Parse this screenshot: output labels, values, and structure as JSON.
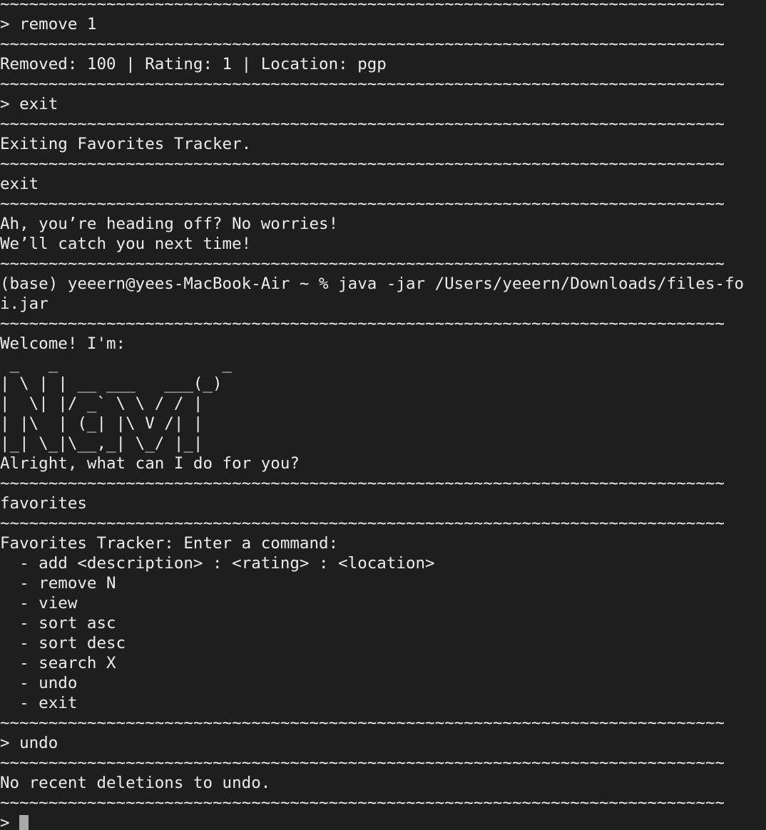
{
  "terminal": {
    "lines": [
      "~~~~~~~~~~~~~~~~~~~~~~~~~~~~~~~~~~~~~~~~~~~~~~~~~~~~~~~~~~~~~~~~~~~~~~~~~~~",
      "> remove 1",
      "~~~~~~~~~~~~~~~~~~~~~~~~~~~~~~~~~~~~~~~~~~~~~~~~~~~~~~~~~~~~~~~~~~~~~~~~~~~",
      "Removed: 100 | Rating: 1 | Location: pgp",
      "~~~~~~~~~~~~~~~~~~~~~~~~~~~~~~~~~~~~~~~~~~~~~~~~~~~~~~~~~~~~~~~~~~~~~~~~~~~",
      "> exit",
      "~~~~~~~~~~~~~~~~~~~~~~~~~~~~~~~~~~~~~~~~~~~~~~~~~~~~~~~~~~~~~~~~~~~~~~~~~~~",
      "Exiting Favorites Tracker.",
      "~~~~~~~~~~~~~~~~~~~~~~~~~~~~~~~~~~~~~~~~~~~~~~~~~~~~~~~~~~~~~~~~~~~~~~~~~~~",
      "exit",
      "~~~~~~~~~~~~~~~~~~~~~~~~~~~~~~~~~~~~~~~~~~~~~~~~~~~~~~~~~~~~~~~~~~~~~~~~~~~",
      "Ah, you’re heading off? No worries!",
      "We’ll catch you next time!",
      "~~~~~~~~~~~~~~~~~~~~~~~~~~~~~~~~~~~~~~~~~~~~~~~~~~~~~~~~~~~~~~~~~~~~~~~~~~~",
      "(base) yeeern@yees-MacBook-Air ~ % java -jar /Users/yeeern/Downloads/files-fo",
      "i.jar",
      "~~~~~~~~~~~~~~~~~~~~~~~~~~~~~~~~~~~~~~~~~~~~~~~~~~~~~~~~~~~~~~~~~~~~~~~~~~~",
      "Welcome! I'm:",
      " _   _                 _ ",
      "| \\ | | __ ___   ___(_)",
      "|  \\| |/ _` \\ \\ / / |",
      "| |\\  | (_| |\\ V /| |",
      "|_| \\_|\\__,_| \\_/ |_|",
      "Alright, what can I do for you?",
      "~~~~~~~~~~~~~~~~~~~~~~~~~~~~~~~~~~~~~~~~~~~~~~~~~~~~~~~~~~~~~~~~~~~~~~~~~~~",
      "favorites",
      "~~~~~~~~~~~~~~~~~~~~~~~~~~~~~~~~~~~~~~~~~~~~~~~~~~~~~~~~~~~~~~~~~~~~~~~~~~~",
      "Favorites Tracker: Enter a command:",
      "  - add <description> : <rating> : <location>",
      "  - remove N",
      "  - view",
      "  - sort asc",
      "  - sort desc",
      "  - search X",
      "  - undo",
      "  - exit",
      "~~~~~~~~~~~~~~~~~~~~~~~~~~~~~~~~~~~~~~~~~~~~~~~~~~~~~~~~~~~~~~~~~~~~~~~~~~~",
      "> undo",
      "~~~~~~~~~~~~~~~~~~~~~~~~~~~~~~~~~~~~~~~~~~~~~~~~~~~~~~~~~~~~~~~~~~~~~~~~~~~",
      "No recent deletions to undo.",
      "~~~~~~~~~~~~~~~~~~~~~~~~~~~~~~~~~~~~~~~~~~~~~~~~~~~~~~~~~~~~~~~~~~~~~~~~~~~"
    ],
    "prompt": "> ",
    "colors": {
      "background": "#1e1e1e",
      "text": "#ececec",
      "cursor": "#a8a8a8"
    }
  }
}
